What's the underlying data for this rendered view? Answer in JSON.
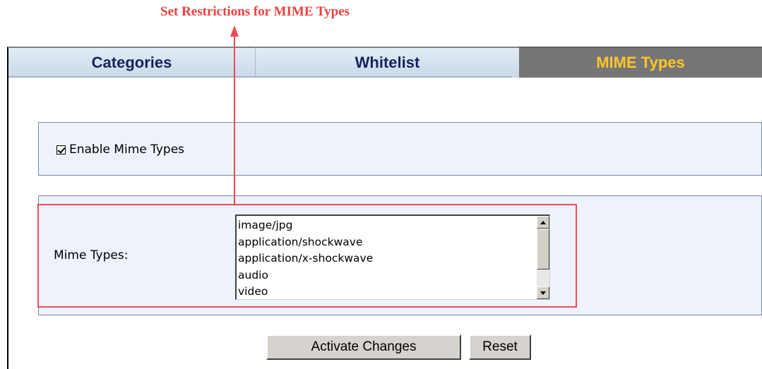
{
  "annotation": {
    "callout_text": "Set Restrictions for MIME Types",
    "color": "#ee4040"
  },
  "tabs": [
    {
      "label": "Categories",
      "active": false
    },
    {
      "label": "Whitelist",
      "active": false
    },
    {
      "label": "MIME Types",
      "active": true
    }
  ],
  "enable_section": {
    "checkbox_label": "Enable Mime Types",
    "checked": true
  },
  "mime_section": {
    "label": "Mime Types:",
    "items": [
      "image/jpg",
      "application/shockwave",
      "application/x-shockwave",
      "audio",
      "video"
    ]
  },
  "buttons": {
    "activate_label": "Activate Changes",
    "reset_label": "Reset"
  },
  "colors": {
    "active_tab_bg": "#767676",
    "active_tab_text": "#ffc629",
    "inactive_tab_text": "#16235f",
    "panel_bg": "#eef3fb",
    "highlight": "#ee4b55"
  }
}
